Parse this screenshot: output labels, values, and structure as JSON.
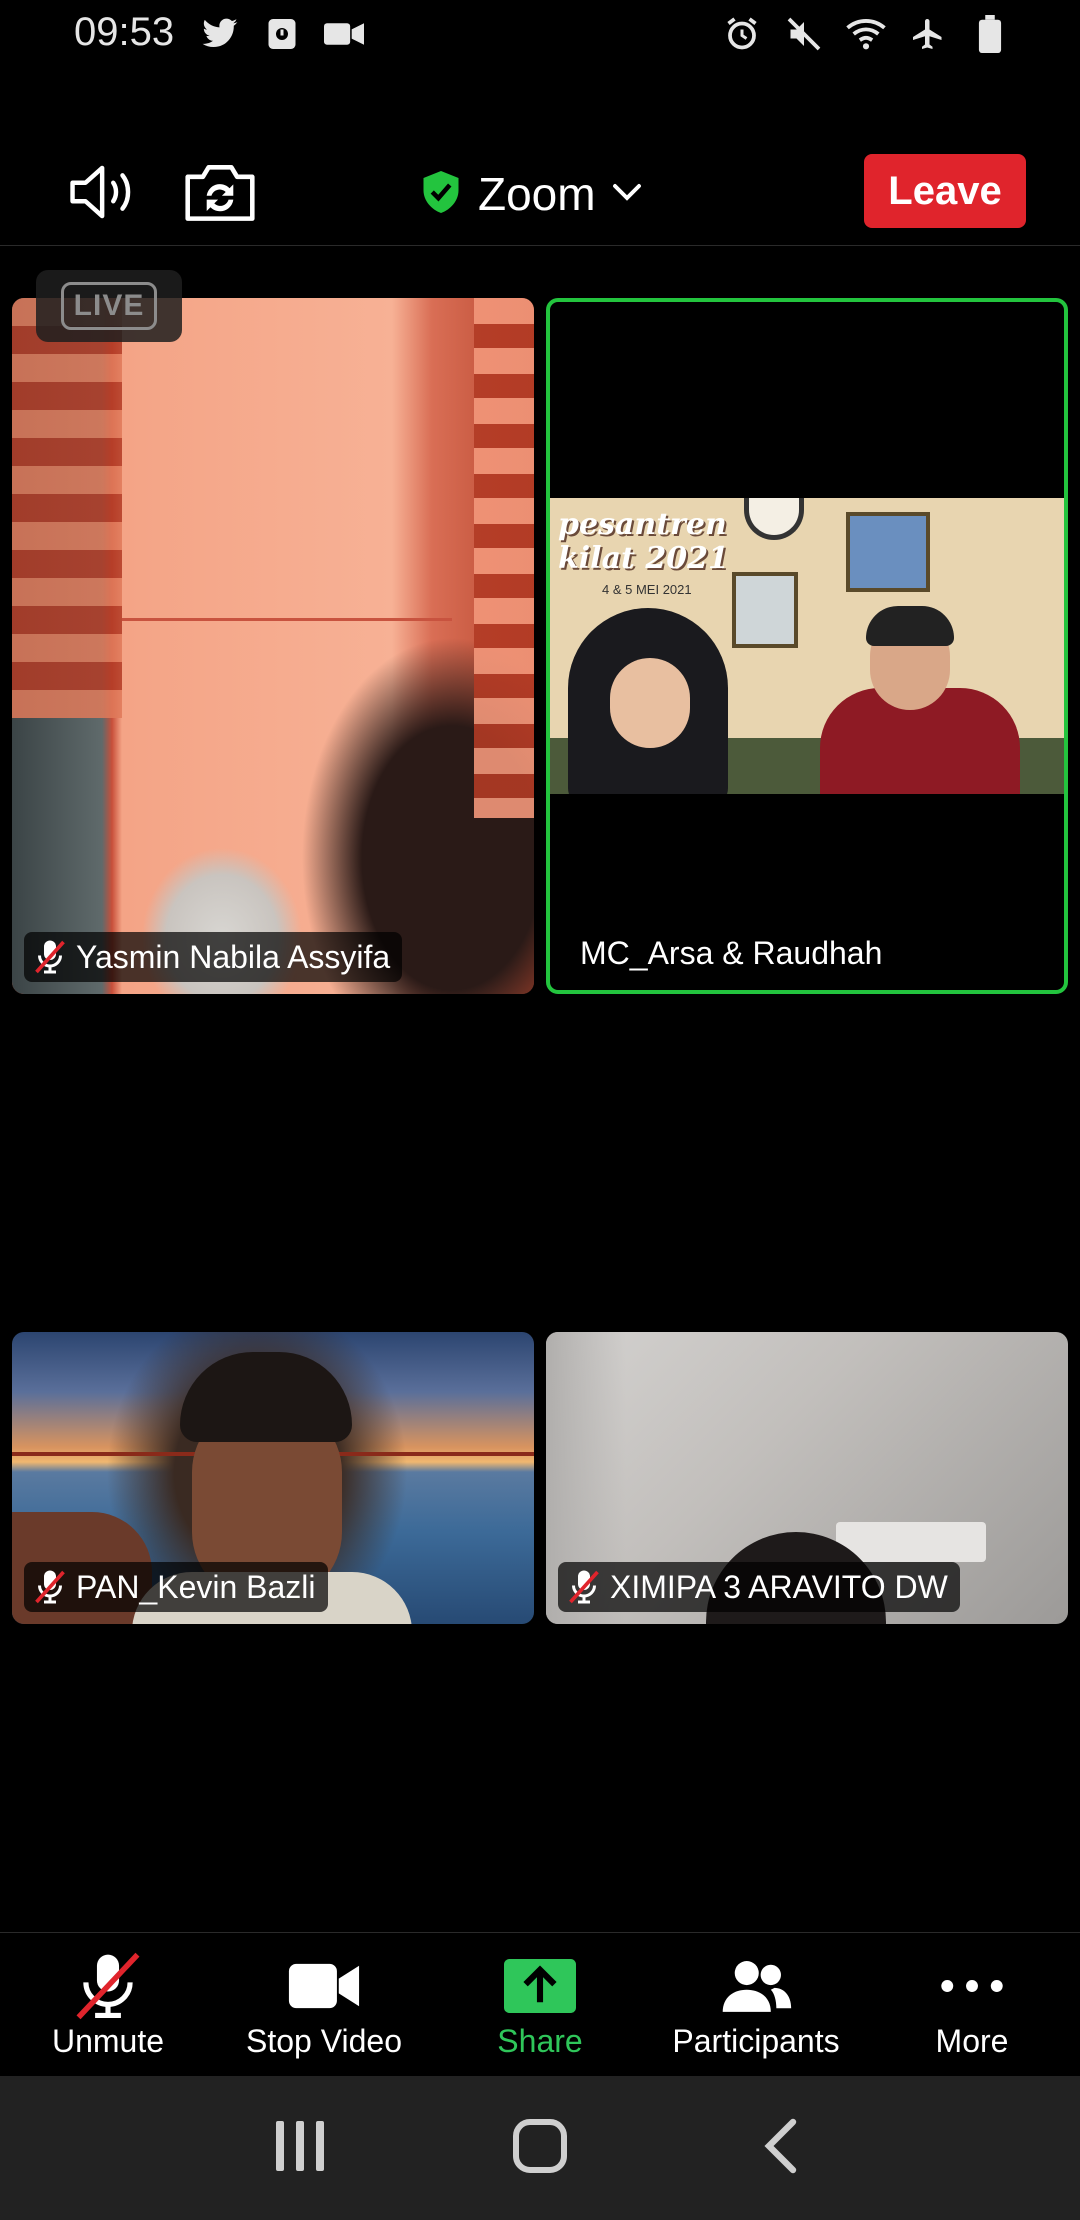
{
  "status_bar": {
    "time": "09:53",
    "left_icons": [
      "twitter-icon",
      "app-notification-icon",
      "video-recording-icon"
    ],
    "right_icons": [
      "alarm-icon",
      "mute-icon",
      "wifi-icon",
      "airplane-icon",
      "battery-icon"
    ]
  },
  "header": {
    "title": "Zoom",
    "leave_label": "Leave",
    "icons": [
      "speaker-icon",
      "switch-camera-icon",
      "shield-check-icon",
      "chevron-down-icon"
    ]
  },
  "live_badge": "LIVE",
  "tiles": [
    {
      "name": "Yasmin Nabila Assyifa",
      "muted": true
    },
    {
      "name": "MC_Arsa & Raudhah",
      "muted": false,
      "active_speaker": true
    },
    {
      "name": "PAN_Kevin Bazli",
      "muted": true
    },
    {
      "name": "XIMIPA 3 ARAVITO DW",
      "muted": true
    }
  ],
  "shared_screen": {
    "title_line1": "pesantren",
    "title_line2": "kilat 2021",
    "subtitle": "4 & 5 MEI 2021"
  },
  "toolbar": {
    "items": [
      {
        "label": "Unmute",
        "icon": "mic-muted-icon"
      },
      {
        "label": "Stop Video",
        "icon": "video-camera-icon"
      },
      {
        "label": "Share",
        "icon": "share-screen-icon"
      },
      {
        "label": "Participants",
        "icon": "participants-icon"
      },
      {
        "label": "More",
        "icon": "more-dots-icon"
      }
    ]
  },
  "colors": {
    "leave": "#e0242c",
    "active_speaker_border": "#23c43e",
    "share_green": "#2fc65a"
  }
}
